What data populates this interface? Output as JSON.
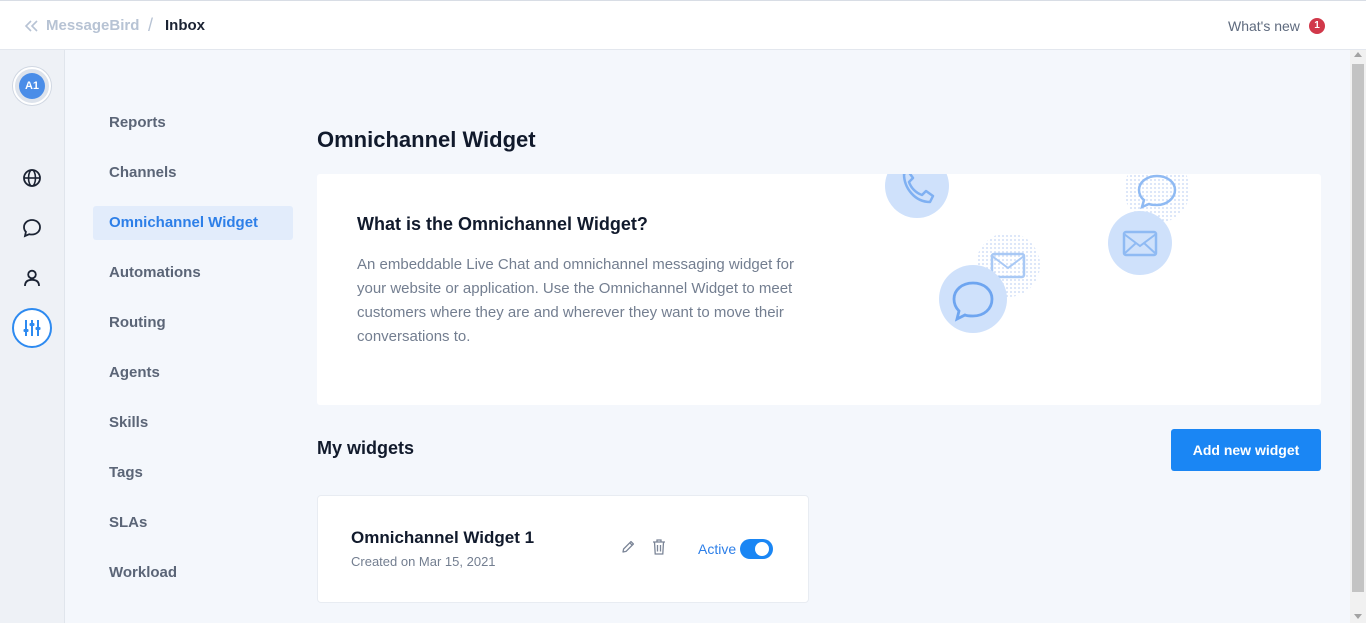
{
  "header": {
    "app_name": "MessageBird",
    "separator": "/",
    "page": "Inbox",
    "whats_new_label": "What's new",
    "whats_new_count": "1"
  },
  "rail": {
    "avatar_initials": "A1",
    "icons": [
      "globe-icon",
      "chat-bubble-icon",
      "user-icon",
      "sliders-icon"
    ],
    "active_icon": "sliders-icon"
  },
  "subnav": {
    "items": [
      {
        "label": "Reports"
      },
      {
        "label": "Channels"
      },
      {
        "label": "Omnichannel Widget"
      },
      {
        "label": "Automations"
      },
      {
        "label": "Routing"
      },
      {
        "label": "Agents"
      },
      {
        "label": "Skills"
      },
      {
        "label": "Tags"
      },
      {
        "label": "SLAs"
      },
      {
        "label": "Workload"
      }
    ],
    "active_index": 2
  },
  "main": {
    "title": "Omnichannel Widget",
    "info": {
      "title": "What is the Omnichannel Widget?",
      "description": "An embeddable Live Chat and omnichannel messaging widget for your website or application. Use the Omnichannel Widget to meet customers where they are and wherever they want to move their conversations to."
    },
    "widgets_section": {
      "title": "My widgets",
      "add_button": "Add new widget",
      "items": [
        {
          "name": "Omnichannel Widget 1",
          "created": "Created on Mar 15, 2021",
          "status": "Active",
          "enabled": true
        }
      ]
    }
  },
  "colors": {
    "accent": "#1a86f4",
    "active_nav_bg": "#e2ecfb",
    "badge": "#d1384a",
    "page_bg": "#f4f7fc"
  }
}
